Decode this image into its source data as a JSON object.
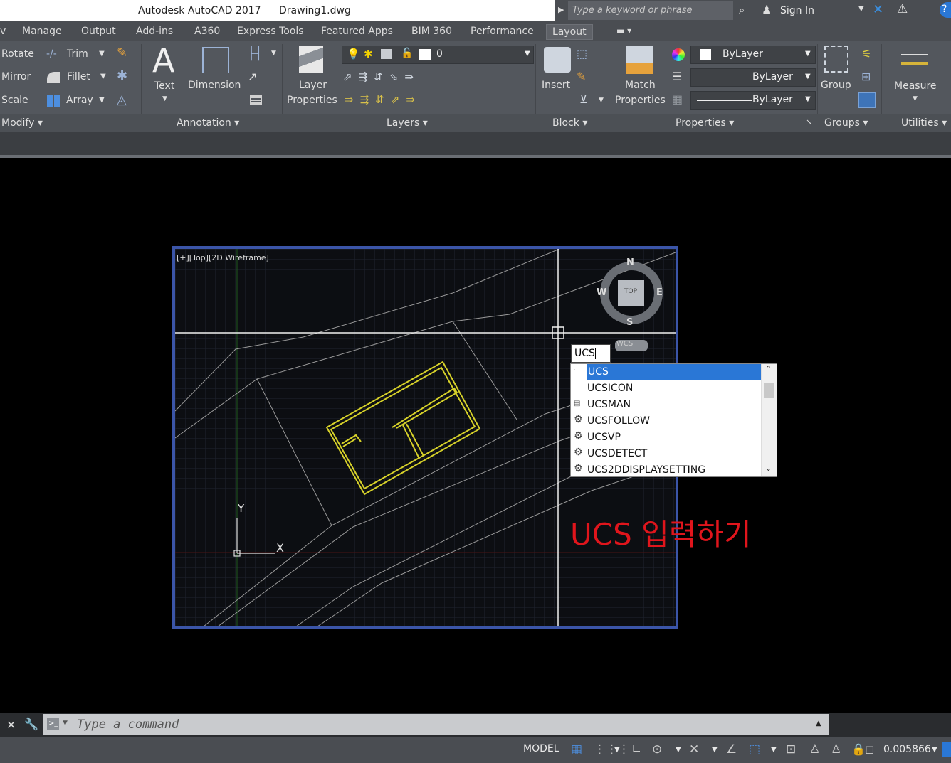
{
  "app": {
    "name": "Autodesk AutoCAD 2017",
    "file": "Drawing1.dwg"
  },
  "search": {
    "placeholder": "Type a keyword or phrase",
    "signin": "Sign In"
  },
  "menu": [
    "Manage",
    "Output",
    "Add-ins",
    "A360",
    "Express Tools",
    "Featured Apps",
    "BIM 360",
    "Performance",
    "Layout"
  ],
  "ribbon": {
    "modify": {
      "rotate": "Rotate",
      "trim": "Trim",
      "mirror": "Mirror",
      "fillet": "Fillet",
      "scale": "Scale",
      "array": "Array",
      "panel": "Modify"
    },
    "annotation": {
      "text": "Text",
      "dimension": "Dimension",
      "panel": "Annotation"
    },
    "layers": {
      "label1": "Layer",
      "label2": "Properties",
      "current": "0",
      "panel": "Layers"
    },
    "block": {
      "insert": "Insert",
      "panel": "Block"
    },
    "properties": {
      "label1": "Match",
      "label2": "Properties",
      "color": "ByLayer",
      "linetype": "ByLayer",
      "lineweight": "ByLayer",
      "panel": "Properties"
    },
    "groups": {
      "group": "Group",
      "panel": "Groups"
    },
    "utilities": {
      "measure": "Measure",
      "panel": "Utilities"
    }
  },
  "viewport": {
    "title": "[+][Top][2D Wireframe]",
    "viewcube": {
      "n": "N",
      "s": "S",
      "e": "E",
      "w": "W",
      "top": "TOP",
      "wcs": "WCS"
    },
    "axis": {
      "x": "X",
      "y": "Y"
    }
  },
  "command": {
    "typed": "UCS",
    "suggestions": [
      "UCS",
      "UCSICON",
      "UCSMAN",
      "UCSFOLLOW",
      "UCSVP",
      "UCSDETECT",
      "UCS2DDISPLAYSETTING"
    ],
    "placeholder": "Type a command"
  },
  "annotation_text": "UCS 입력하기",
  "status": {
    "mode": "MODEL",
    "value": "0.005866"
  },
  "colors": {
    "accent": "#2a77d6",
    "viewport_border": "#3b55a8",
    "drawing": "#d7d22a",
    "annotation": "#e0151c"
  }
}
